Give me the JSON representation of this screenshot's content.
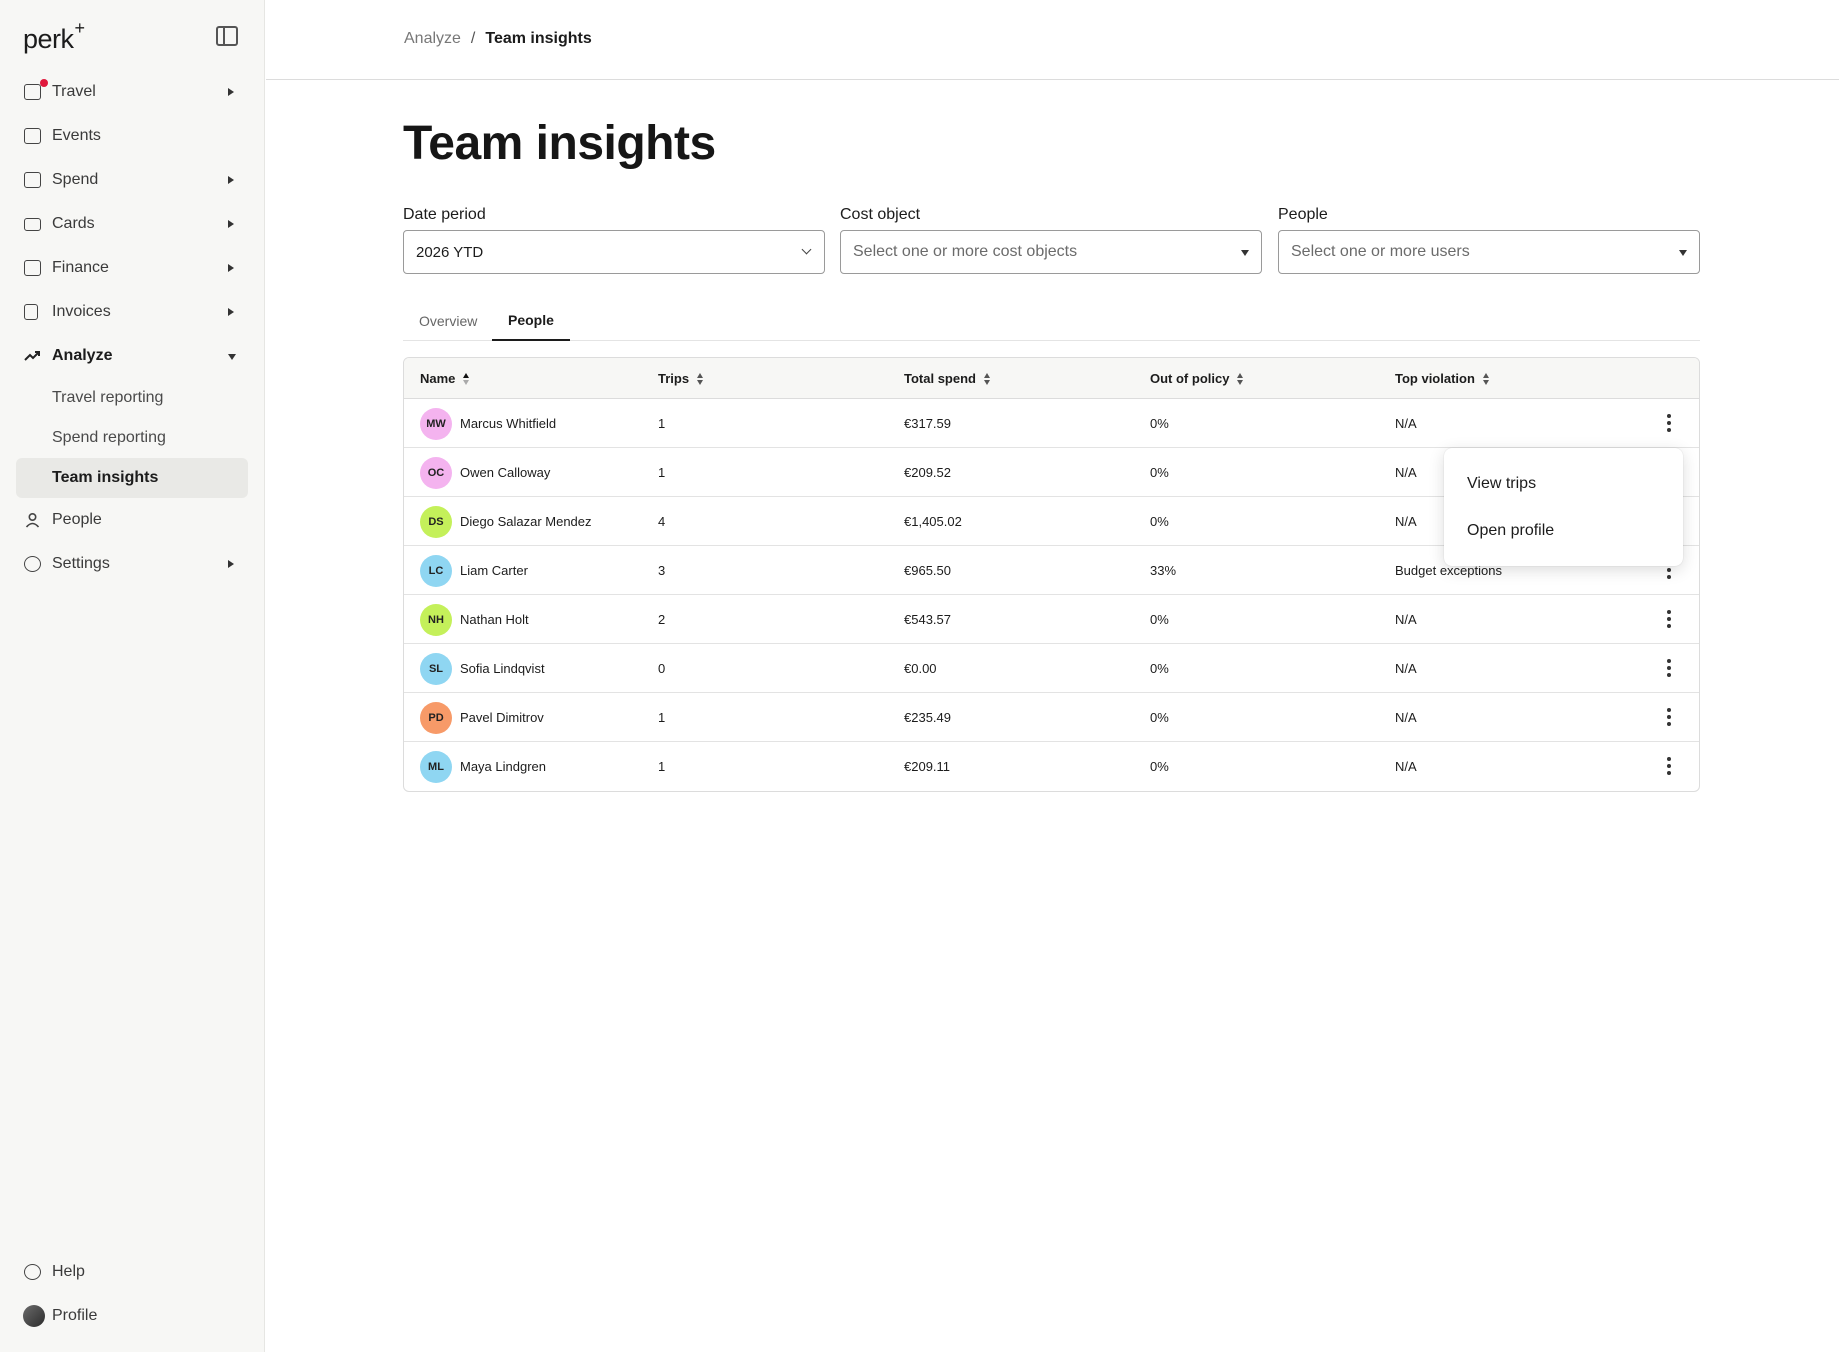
{
  "brand": {
    "name": "perk",
    "mark": "+"
  },
  "sidebar": {
    "items": [
      {
        "label": "Travel",
        "icon": "suitcase-icon",
        "has_arrow": true,
        "has_dot": true
      },
      {
        "label": "Events",
        "icon": "calendar-icon",
        "has_arrow": false
      },
      {
        "label": "Spend",
        "icon": "money-icon",
        "has_arrow": true
      },
      {
        "label": "Cards",
        "icon": "card-icon",
        "has_arrow": true
      },
      {
        "label": "Finance",
        "icon": "ledger-icon",
        "has_arrow": true
      },
      {
        "label": "Invoices",
        "icon": "document-icon",
        "has_arrow": true
      },
      {
        "label": "Analyze",
        "icon": "trend-icon",
        "has_arrow": true,
        "expanded": true
      }
    ],
    "analyze_sub": [
      {
        "label": "Travel reporting"
      },
      {
        "label": "Spend reporting"
      },
      {
        "label": "Team insights",
        "active": true
      }
    ],
    "bottom_items": [
      {
        "label": "People",
        "icon": "person-icon"
      },
      {
        "label": "Settings",
        "icon": "gear-icon",
        "has_arrow": true
      }
    ],
    "footer": {
      "help": "Help",
      "profile": "Profile"
    }
  },
  "breadcrumb": {
    "parent": "Analyze",
    "separator": "/",
    "current": "Team insights"
  },
  "page_title": "Team insights",
  "filters": {
    "date_period": {
      "label": "Date period",
      "value": "2026 YTD"
    },
    "cost_object": {
      "label": "Cost object",
      "placeholder": "Select one or more cost objects"
    },
    "people": {
      "label": "People",
      "placeholder": "Select one or more users"
    }
  },
  "tabs": [
    {
      "label": "Overview"
    },
    {
      "label": "People",
      "active": true
    }
  ],
  "table": {
    "headers": {
      "name": "Name",
      "trips": "Trips",
      "total_spend": "Total spend",
      "out_of_policy": "Out of policy",
      "top_violation": "Top violation"
    },
    "rows": [
      {
        "initials": "MW",
        "name": "Marcus Whitfield",
        "trips": "1",
        "spend": "€317.59",
        "oop": "0%",
        "violation": "N/A",
        "color": "#f4b3ef"
      },
      {
        "initials": "OC",
        "name": "Owen Calloway",
        "trips": "1",
        "spend": "€209.52",
        "oop": "0%",
        "violation": "N/A",
        "color": "#f4b3ef"
      },
      {
        "initials": "DS",
        "name": "Diego Salazar Mendez",
        "trips": "4",
        "spend": "€1,405.02",
        "oop": "0%",
        "violation": "N/A",
        "color": "#c4f05a"
      },
      {
        "initials": "LC",
        "name": "Liam Carter",
        "trips": "3",
        "spend": "€965.50",
        "oop": "33%",
        "violation": "Budget exceptions",
        "color": "#8fd6f2"
      },
      {
        "initials": "NH",
        "name": "Nathan Holt",
        "trips": "2",
        "spend": "€543.57",
        "oop": "0%",
        "violation": "N/A",
        "color": "#c4f05a"
      },
      {
        "initials": "SL",
        "name": "Sofia Lindqvist",
        "trips": "0",
        "spend": "€0.00",
        "oop": "0%",
        "violation": "N/A",
        "color": "#8fd6f2"
      },
      {
        "initials": "PD",
        "name": "Pavel Dimitrov",
        "trips": "1",
        "spend": "€235.49",
        "oop": "0%",
        "violation": "N/A",
        "color": "#f79a68"
      },
      {
        "initials": "ML",
        "name": "Maya Lindgren",
        "trips": "1",
        "spend": "€209.11",
        "oop": "0%",
        "violation": "N/A",
        "color": "#8fd6f2"
      }
    ]
  },
  "context_menu": {
    "items": [
      {
        "label": "View trips"
      },
      {
        "label": "Open profile"
      }
    ]
  }
}
